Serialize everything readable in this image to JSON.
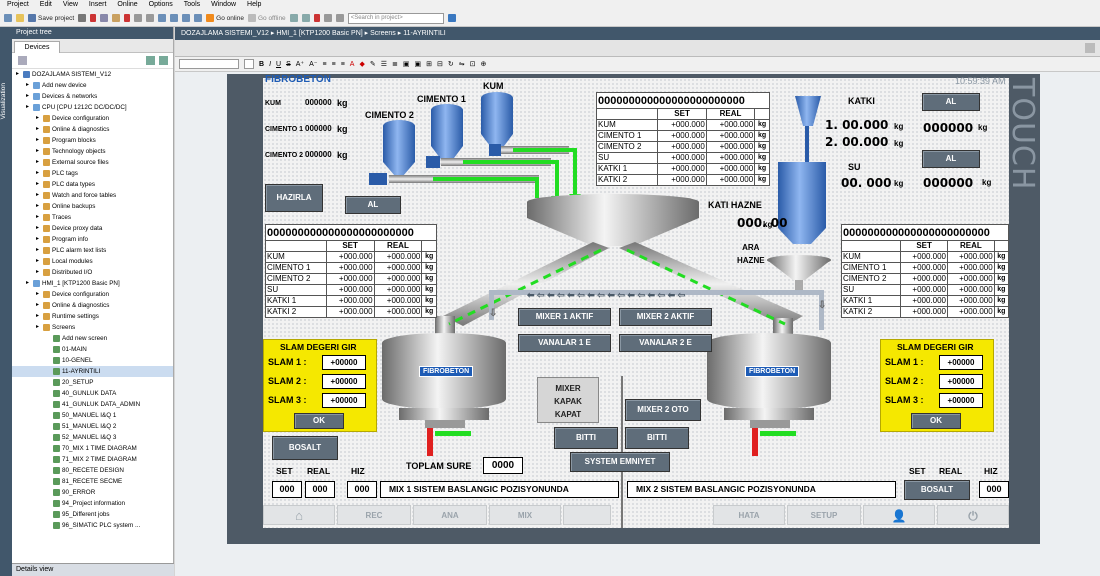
{
  "menu": [
    "Project",
    "Edit",
    "View",
    "Insert",
    "Online",
    "Options",
    "Tools",
    "Window",
    "Help"
  ],
  "toolbar": {
    "save": "Save project",
    "go_online": "Go online",
    "go_offline": "Go offline",
    "search_placeholder": "<Search in project>"
  },
  "left_strip": "Visualization",
  "project_tree": {
    "title": "Project tree",
    "tab": "Devices",
    "items": [
      {
        "label": "DOZAJLAMA SISTEMI_V12",
        "indent": 0
      },
      {
        "label": "Add new device",
        "indent": 1
      },
      {
        "label": "Devices & networks",
        "indent": 1
      },
      {
        "label": "CPU [CPU 1212C DC/DC/DC]",
        "indent": 1
      },
      {
        "label": "Device configuration",
        "indent": 2
      },
      {
        "label": "Online & diagnostics",
        "indent": 2
      },
      {
        "label": "Program blocks",
        "indent": 2
      },
      {
        "label": "Technology objects",
        "indent": 2
      },
      {
        "label": "External source files",
        "indent": 2
      },
      {
        "label": "PLC tags",
        "indent": 2
      },
      {
        "label": "PLC data types",
        "indent": 2
      },
      {
        "label": "Watch and force tables",
        "indent": 2
      },
      {
        "label": "Online backups",
        "indent": 2
      },
      {
        "label": "Traces",
        "indent": 2
      },
      {
        "label": "Device proxy data",
        "indent": 2
      },
      {
        "label": "Program info",
        "indent": 2
      },
      {
        "label": "PLC alarm text lists",
        "indent": 2
      },
      {
        "label": "Local modules",
        "indent": 2
      },
      {
        "label": "Distributed I/O",
        "indent": 2
      },
      {
        "label": "HMI_1 [KTP1200 Basic PN]",
        "indent": 1
      },
      {
        "label": "Device configuration",
        "indent": 2
      },
      {
        "label": "Online & diagnostics",
        "indent": 2
      },
      {
        "label": "Runtime settings",
        "indent": 2
      },
      {
        "label": "Screens",
        "indent": 2
      },
      {
        "label": "Add new screen",
        "indent": 3
      },
      {
        "label": "01-MAIN",
        "indent": 3
      },
      {
        "label": "10-GENEL",
        "indent": 3
      },
      {
        "label": "11-AYRINTILI",
        "indent": 3
      },
      {
        "label": "20_SETUP",
        "indent": 3
      },
      {
        "label": "40_GUNLUK DATA",
        "indent": 3
      },
      {
        "label": "41_GUNLUK DATA_ADMIN",
        "indent": 3
      },
      {
        "label": "50_MANUEL I&Q 1",
        "indent": 3
      },
      {
        "label": "51_MANUEL I&Q 2",
        "indent": 3
      },
      {
        "label": "52_MANUEL I&Q 3",
        "indent": 3
      },
      {
        "label": "70_MIX 1 TIME DIAGRAM",
        "indent": 3
      },
      {
        "label": "71_MIX 2 TIME DIAGRAM",
        "indent": 3
      },
      {
        "label": "80_RECETE DESIGN",
        "indent": 3
      },
      {
        "label": "81_RECETE SECME",
        "indent": 3
      },
      {
        "label": "90_ERROR",
        "indent": 3
      },
      {
        "label": "94_Project information",
        "indent": 3
      },
      {
        "label": "95_Different jobs",
        "indent": 3
      },
      {
        "label": "96_SIMATIC PLC system ...",
        "indent": 3
      }
    ],
    "selected_index": 27,
    "details": "Details view"
  },
  "breadcrumb": [
    "DOZAJLAMA SISTEMI_V12",
    "HMI_1 [KTP1200 Basic PN]",
    "Screens",
    "11-AYRINTILI"
  ],
  "hmi": {
    "time": "10:59:39 AM",
    "brand": "TOUCH",
    "logo": "FIBROBETON",
    "silos": {
      "cimento1": "CIMENTO 1",
      "cimento2": "CIMENTO 2",
      "kum": "KUM"
    },
    "weights": [
      {
        "label": "KUM",
        "value": "000000",
        "unit": "kg"
      },
      {
        "label": "CIMENTO 1",
        "value": "000000",
        "unit": "kg"
      },
      {
        "label": "CIMENTO 2",
        "value": "000000",
        "unit": "kg"
      }
    ],
    "hazirla": "HAZIRLA",
    "al": "AL",
    "katki": {
      "label": "KATKI",
      "v1": "1. 00.000",
      "v2": "2. 00.000",
      "unit": "kg",
      "right": "000000",
      "al": "AL"
    },
    "su": {
      "label": "SU",
      "value": "00. 000",
      "unit": "kg",
      "right": "000000"
    },
    "kati_hazne": {
      "label": "KATI HAZNE",
      "value": "000. 00",
      "unit": "kg"
    },
    "ara_hazne": "ARA\nHAZNE",
    "table_top": {
      "header": "000000000000000000000000",
      "set": "SET",
      "real": "REAL",
      "rows": [
        [
          "KUM",
          "+000.000",
          "+000.000",
          "kg"
        ],
        [
          "CIMENTO 1",
          "+000.000",
          "+000.000",
          "kg"
        ],
        [
          "CIMENTO 2",
          "+000.000",
          "+000.000",
          "kg"
        ],
        [
          "SU",
          "+000.000",
          "+000.000",
          "kg"
        ],
        [
          "KATKI 1",
          "+000.000",
          "+000.000",
          "kg"
        ],
        [
          "KATKI 2",
          "+000.000",
          "+000.000",
          "kg"
        ]
      ]
    },
    "mixer1_aktif": "MIXER 1 AKTIF",
    "mixer2_aktif": "MIXER 2 AKTIF",
    "vanalar1": "VANALAR 1 E",
    "vanalar2": "VANALAR 2 E",
    "slam": {
      "title": "SLAM DEGERI GIR",
      "rows": [
        "SLAM 1 :",
        "SLAM 2 :",
        "SLAM 3 :"
      ],
      "value": "+00000",
      "ok": "OK"
    },
    "mixer_kapak": "MIXER\nKAPAK\nKAPAT",
    "mixer2_oto": "MIXER 2 OTO",
    "bitti": "BITTI",
    "system_emniyet": "SYSTEM EMNIYET",
    "bosalt": "BOSALT",
    "toplam_sure": "TOPLAM SURE",
    "toplam_value": "0000",
    "set": "SET",
    "real": "REAL",
    "hiz": "HIZ",
    "triple": "000",
    "mix1_status": "MIX 1 SISTEM BASLANGIC POZISYONUNDA",
    "mix2_status": "MIX 2 SISTEM BASLANGIC POZISYONUNDA",
    "nav": [
      "REC",
      "ANA",
      "MIX",
      "HATA",
      "SETUP"
    ]
  }
}
